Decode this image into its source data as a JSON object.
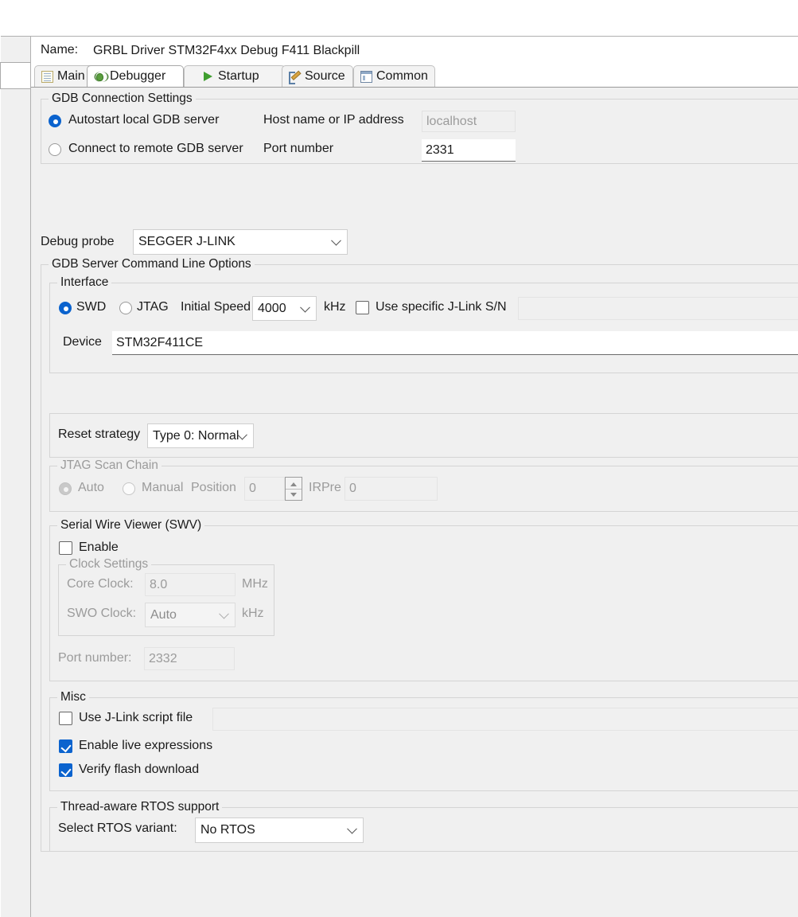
{
  "window": {
    "name_label": "Name:",
    "name_value": "GRBL Driver STM32F4xx Debug F411 Blackpill"
  },
  "tabs": [
    {
      "label": "Main",
      "icon": "document-icon",
      "active": false
    },
    {
      "label": "Debugger",
      "icon": "bug-icon",
      "active": true
    },
    {
      "label": "Startup",
      "icon": "play-icon",
      "active": false
    },
    {
      "label": "Source",
      "icon": "source-pencil-icon",
      "active": false
    },
    {
      "label": "Common",
      "icon": "window-icon",
      "active": false
    }
  ],
  "gdb_connection": {
    "legend": "GDB Connection Settings",
    "autostart_label": "Autostart local GDB server",
    "autostart_selected": true,
    "remote_label": "Connect to remote GDB server",
    "remote_selected": false,
    "host_label": "Host name or IP address",
    "host_value": "localhost",
    "port_label": "Port number",
    "port_value": "2331"
  },
  "debug_probe": {
    "label": "Debug probe",
    "value": "SEGGER J-LINK"
  },
  "gdb_server": {
    "legend": "GDB Server Command Line Options",
    "interface": {
      "legend": "Interface",
      "swd_label": "SWD",
      "swd_selected": true,
      "jtag_label": "JTAG",
      "jtag_selected": false,
      "initial_speed_label": "Initial Speed",
      "initial_speed_value": "4000",
      "khz_label": "kHz",
      "use_sn_label": "Use specific J-Link S/N",
      "use_sn_checked": false,
      "sn_value": "",
      "device_label": "Device",
      "device_value": "STM32F411CE"
    },
    "reset_strategy": {
      "label": "Reset strategy",
      "value": "Type 0: Normal"
    },
    "jtag_scan_chain": {
      "legend": "JTAG Scan Chain",
      "auto_label": "Auto",
      "auto_selected": true,
      "manual_label": "Manual",
      "manual_selected": false,
      "position_label": "Position",
      "position_value": "0",
      "irpre_label": "IRPre",
      "irpre_value": "0"
    },
    "swv": {
      "legend": "Serial Wire Viewer (SWV)",
      "enable_label": "Enable",
      "enable_checked": false,
      "clock_settings": {
        "legend": "Clock Settings",
        "core_clock_label": "Core Clock:",
        "core_clock_value": "8.0",
        "mhz_label": "MHz",
        "swo_clock_label": "SWO Clock:",
        "swo_clock_value": "Auto",
        "khz_label": "kHz"
      },
      "port_label": "Port number:",
      "port_value": "2332"
    },
    "misc": {
      "legend": "Misc",
      "script_label": "Use J-Link script file",
      "script_checked": false,
      "script_value": "",
      "live_expr_label": "Enable live expressions",
      "live_expr_checked": true,
      "verify_label": "Verify flash download",
      "verify_checked": true
    },
    "rtos": {
      "legend": "Thread-aware RTOS support",
      "select_label": "Select RTOS variant:",
      "value": "No RTOS"
    }
  },
  "colors": {
    "accent": "#0b63ce",
    "panel_bg": "#f0f0f0",
    "field_bg": "#ffffff",
    "disabled_text": "#9b9b9b"
  }
}
